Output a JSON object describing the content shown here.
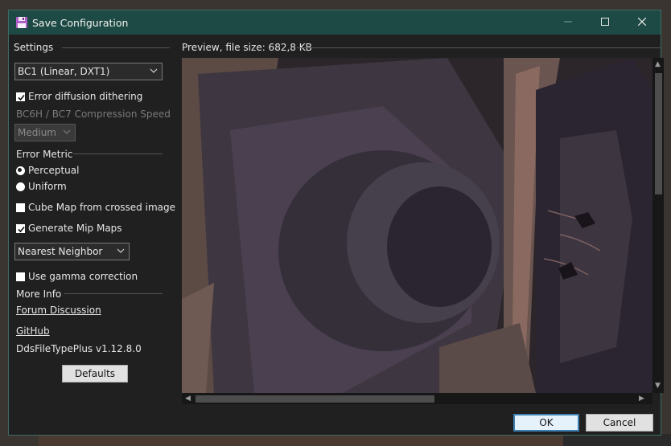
{
  "window": {
    "title": "Save Configuration",
    "accent_color": "#1e4a45",
    "icons": {
      "app": "floppy-disk-icon",
      "minimize": "minimize-icon",
      "maximize": "maximize-icon",
      "close": "close-icon"
    }
  },
  "settings": {
    "group_label": "Settings",
    "format_value": "BC1 (Linear, DXT1)",
    "error_diffusion_label": "Error diffusion dithering",
    "error_diffusion_checked": true,
    "compression_speed_label": "BC6H / BC7 Compression Speed",
    "compression_speed_value": "Medium",
    "error_metric_label": "Error Metric",
    "metric_options": [
      {
        "label": "Perceptual",
        "selected": true
      },
      {
        "label": "Uniform",
        "selected": false
      }
    ],
    "cube_map_label": "Cube Map from crossed image",
    "cube_map_checked": false,
    "mip_maps_label": "Generate Mip Maps",
    "mip_maps_checked": true,
    "mip_filter_value": "Nearest Neighbor",
    "gamma_label": "Use gamma correction",
    "gamma_checked": false,
    "more_info_label": "More Info",
    "forum_link": "Forum Discussion",
    "github_link": "GitHub",
    "version": "DdsFileTypePlus v1.12.8.0",
    "defaults_button": "Defaults"
  },
  "preview": {
    "label": "Preview, file size: 682,8 KB"
  },
  "footer": {
    "ok_label": "OK",
    "cancel_label": "Cancel"
  }
}
